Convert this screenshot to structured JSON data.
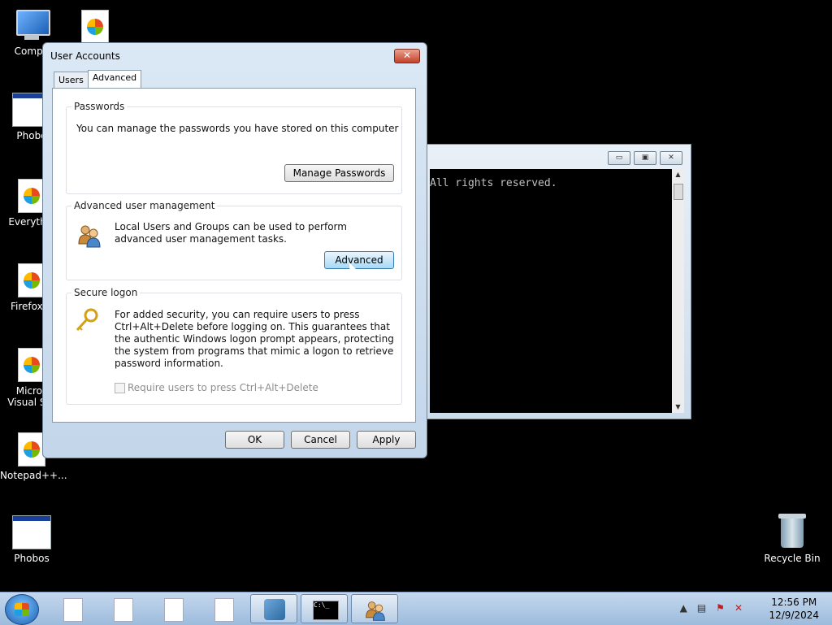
{
  "desktop": {
    "icons": [
      {
        "label": "Compu"
      },
      {
        "label": "Phobo"
      },
      {
        "label": "Everythin"
      },
      {
        "label": "Firefox.Ir"
      },
      {
        "label": "Micros"
      },
      {
        "label": "Visual Stu"
      },
      {
        "label": "Notepad++..."
      },
      {
        "label": "Phobos"
      },
      {
        "label": "Recycle Bin"
      }
    ]
  },
  "console": {
    "text": "All rights reserved.",
    "minimize": "▭",
    "maximize": "▣",
    "close": "✕"
  },
  "dialog": {
    "title": "User Accounts",
    "close": "✕",
    "tabs": [
      {
        "label": "Users"
      },
      {
        "label": "Advanced"
      }
    ],
    "passwords": {
      "heading": "Passwords",
      "text": "You can manage the passwords you have stored on this computer",
      "button": "Manage Passwords"
    },
    "advanced": {
      "heading": "Advanced user management",
      "text": "Local Users and Groups can be used to perform advanced user management tasks.",
      "button": "Advanced"
    },
    "secure": {
      "heading": "Secure logon",
      "text": "For added security, you can require users to press Ctrl+Alt+Delete before logging on. This guarantees that the authentic Windows logon prompt appears, protecting the system from programs that mimic a logon to retrieve password information.",
      "checkbox": "Require users to press Ctrl+Alt+Delete"
    },
    "footer": {
      "ok": "OK",
      "cancel": "Cancel",
      "apply": "Apply"
    }
  },
  "taskbar": {
    "cmd_glyph": "C:\\_",
    "tray_up": "▲",
    "time": "12:56 PM",
    "date": "12/9/2024"
  }
}
